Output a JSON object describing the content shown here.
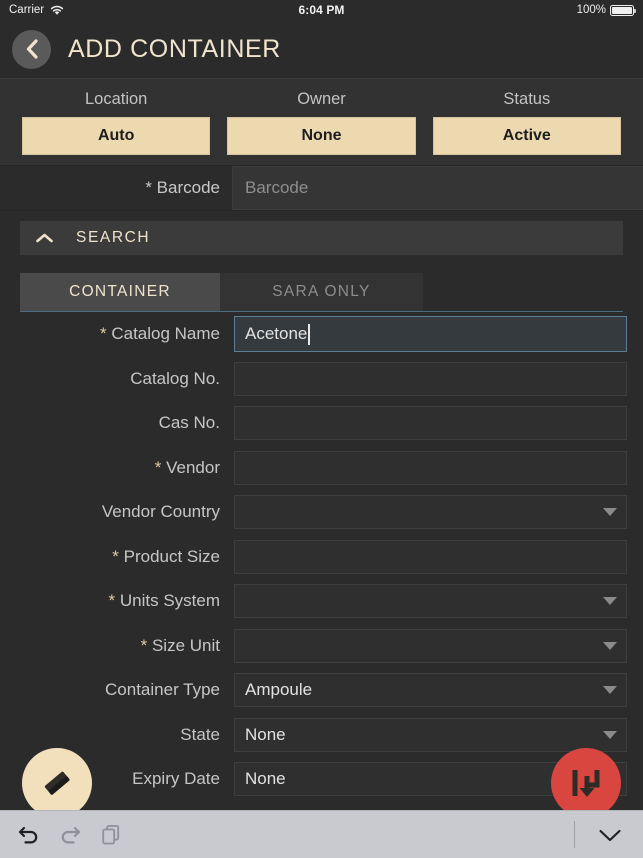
{
  "status_bar": {
    "carrier": "Carrier",
    "wifi_icon": "wifi-icon",
    "time": "6:04 PM",
    "battery_percent": "100%",
    "battery_icon": "battery-full-icon"
  },
  "header": {
    "back_icon": "chevron-left-icon",
    "title": "ADD CONTAINER"
  },
  "selectors": [
    {
      "header": "Location",
      "value": "Auto"
    },
    {
      "header": "Owner",
      "value": "None"
    },
    {
      "header": "Status",
      "value": "Active"
    }
  ],
  "barcode": {
    "label": "* Barcode",
    "placeholder": "Barcode",
    "value": ""
  },
  "search_section": {
    "label": "SEARCH",
    "collapse_icon": "chevron-up-icon"
  },
  "tabs": [
    {
      "label": "CONTAINER",
      "active": true
    },
    {
      "label": "SARA ONLY",
      "active": false
    }
  ],
  "fields": [
    {
      "label": "* Catalog Name",
      "value": "Acetone",
      "type": "text",
      "focused": true
    },
    {
      "label": "Catalog No.",
      "value": "",
      "type": "text",
      "focused": false
    },
    {
      "label": "Cas No.",
      "value": "",
      "type": "text",
      "focused": false
    },
    {
      "label": "* Vendor",
      "value": "",
      "type": "text",
      "focused": false
    },
    {
      "label": "Vendor Country",
      "value": "",
      "type": "select",
      "focused": false
    },
    {
      "label": "* Product Size",
      "value": "",
      "type": "text",
      "focused": false
    },
    {
      "label": "* Units System",
      "value": "",
      "type": "select",
      "focused": false
    },
    {
      "label": "* Size Unit",
      "value": "",
      "type": "select",
      "focused": false
    },
    {
      "label": "Container Type",
      "value": "Ampoule",
      "type": "select",
      "focused": false
    },
    {
      "label": "State",
      "value": "None",
      "type": "select",
      "focused": false
    },
    {
      "label": "Expiry Date",
      "value": "None",
      "type": "text",
      "focused": false
    }
  ],
  "fabs": [
    {
      "name": "eraser-fab",
      "icon": "eraser-icon",
      "color": "#f2e0bd"
    },
    {
      "name": "save-fab",
      "icon": "save-to-tray-icon",
      "color": "#d9453f"
    }
  ],
  "keyboard_bar": {
    "undo_icon": "undo-icon",
    "redo_icon": "redo-icon",
    "paste_icon": "copy-paste-icon",
    "dismiss_icon": "chevron-down-icon"
  },
  "colors": {
    "background": "#2b2b2b",
    "accent_cream": "#f0e4cd",
    "button_tan": "#edd9b0",
    "fab_red": "#d9453f",
    "focus_blue": "#5d7f94",
    "keyboard_bar": "#c8cacf"
  }
}
